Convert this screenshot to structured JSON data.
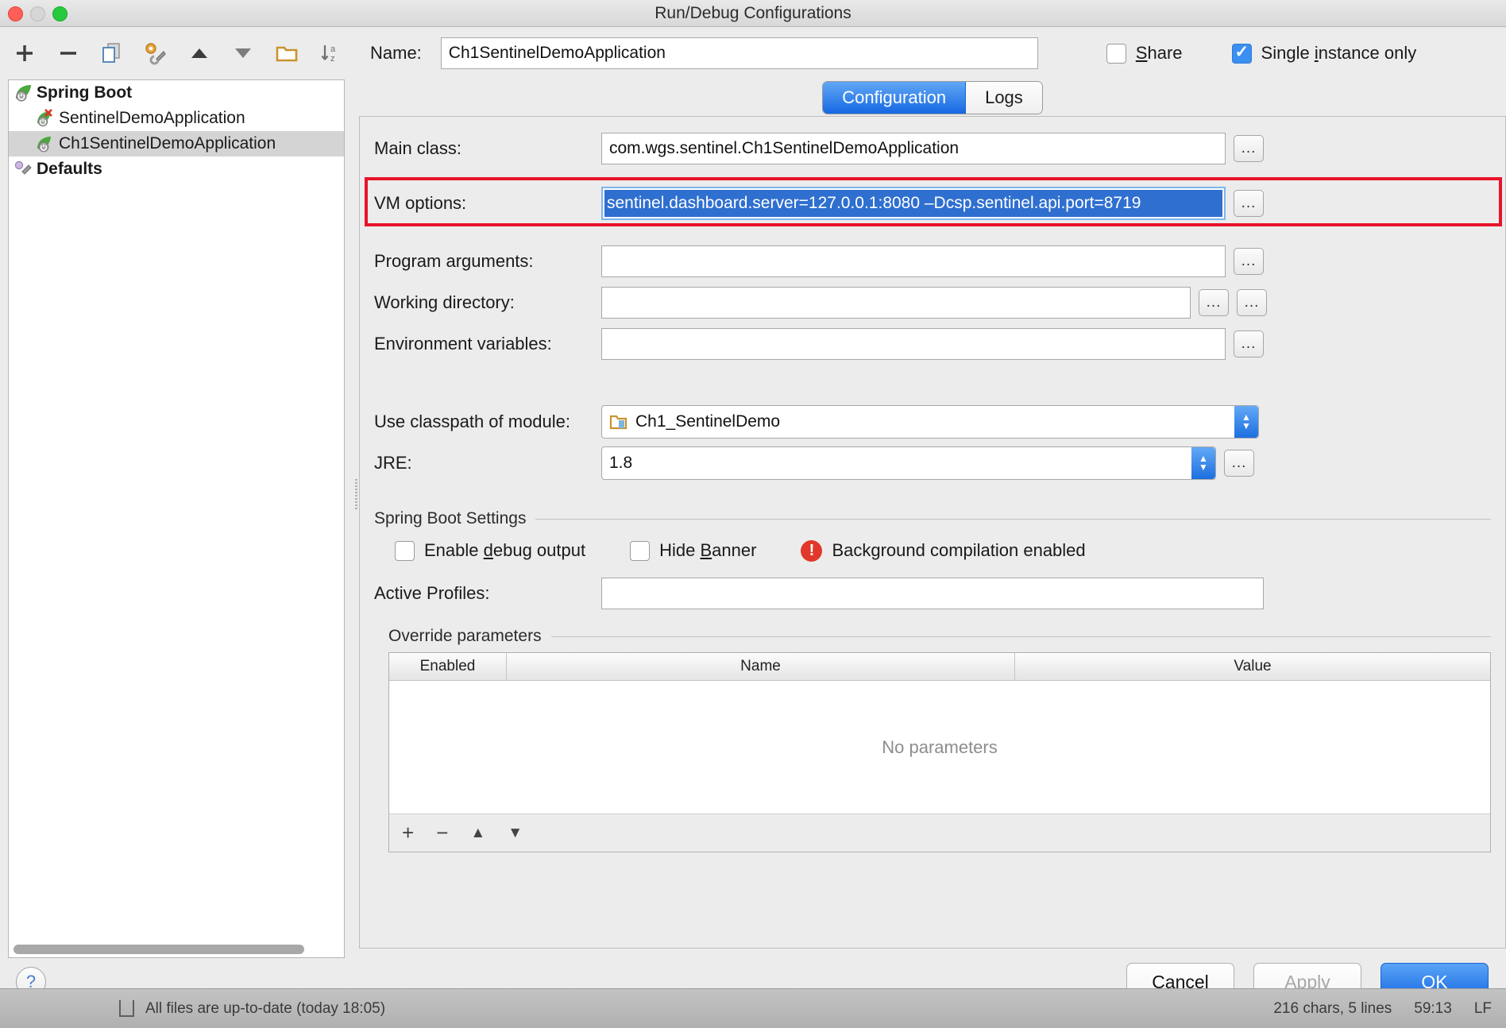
{
  "window": {
    "title": "Run/Debug Configurations",
    "traffic": [
      "close",
      "minimize",
      "zoom"
    ]
  },
  "toolbar": {
    "items": [
      {
        "name": "add",
        "glyph": "+"
      },
      {
        "name": "remove",
        "glyph": "−"
      },
      {
        "name": "copy",
        "glyph": "copy"
      },
      {
        "name": "edit-templates",
        "glyph": "wrench"
      },
      {
        "name": "move-up",
        "glyph": "▲"
      },
      {
        "name": "move-down",
        "glyph": "▼"
      },
      {
        "name": "folder",
        "glyph": "folder"
      },
      {
        "name": "sort-alphabetically",
        "glyph": "sort-az"
      }
    ]
  },
  "tree": {
    "nodes": [
      {
        "label": "Spring Boot",
        "type": "group",
        "icon": "spring-leaf-icon",
        "selected": false
      },
      {
        "label": "SentinelDemoApplication",
        "type": "child",
        "icon": "spring-leaf-error-icon",
        "selected": false
      },
      {
        "label": "Ch1SentinelDemoApplication",
        "type": "child",
        "icon": "spring-leaf-icon",
        "selected": true
      },
      {
        "label": "Defaults",
        "type": "group",
        "icon": "wrench-icon",
        "selected": false
      }
    ]
  },
  "header": {
    "name_label": "Name:",
    "name_value": "Ch1SentinelDemoApplication",
    "share_label": "Share",
    "share_checked": false,
    "single_instance_label": "Single instance only",
    "single_instance_checked": true
  },
  "tabs": [
    {
      "label": "Configuration",
      "active": true
    },
    {
      "label": "Logs",
      "active": false
    }
  ],
  "form": {
    "main_class_label": "Main class:",
    "main_class_value": "com.wgs.sentinel.Ch1SentinelDemoApplication",
    "vm_options_label": "VM options:",
    "vm_options_value": "sentinel.dashboard.server=127.0.0.1:8080 –Dcsp.sentinel.api.port=8719",
    "vm_options_selected": true,
    "program_arguments_label": "Program arguments:",
    "program_arguments_value": "",
    "working_directory_label": "Working directory:",
    "working_directory_value": "",
    "environment_variables_label": "Environment variables:",
    "environment_variables_value": "",
    "classpath_label": "Use classpath of module:",
    "classpath_value": "Ch1_SentinelDemo",
    "jre_label": "JRE:",
    "jre_value": "1.8",
    "ellipsis": "..."
  },
  "spring_boot_settings": {
    "title": "Spring Boot Settings",
    "enable_debug_label": "Enable debug output",
    "enable_debug_checked": false,
    "hide_banner_label": "Hide Banner",
    "hide_banner_checked": false,
    "background_compilation_label": "Background compilation enabled",
    "active_profiles_label": "Active Profiles:",
    "active_profiles_value": ""
  },
  "override_parameters": {
    "title": "Override parameters",
    "columns": [
      "Enabled",
      "Name",
      "Value"
    ],
    "empty_text": "No parameters",
    "rows": [],
    "toolbar": [
      "+",
      "−",
      "▲",
      "▼"
    ]
  },
  "footer": {
    "help_label": "?",
    "cancel_label": "Cancel",
    "apply_label": "Apply",
    "apply_enabled": false,
    "ok_label": "OK"
  },
  "statusbar": {
    "message": "All files are up-to-date (today 18:05)",
    "chars": "216 chars, 5 lines",
    "position": "59:13",
    "encoding": "LF"
  },
  "colors": {
    "accent_blue": "#1668e3",
    "highlight_red": "#e8132b",
    "selection_blue": "#2f6fd0",
    "warning_red": "#e0392b"
  }
}
